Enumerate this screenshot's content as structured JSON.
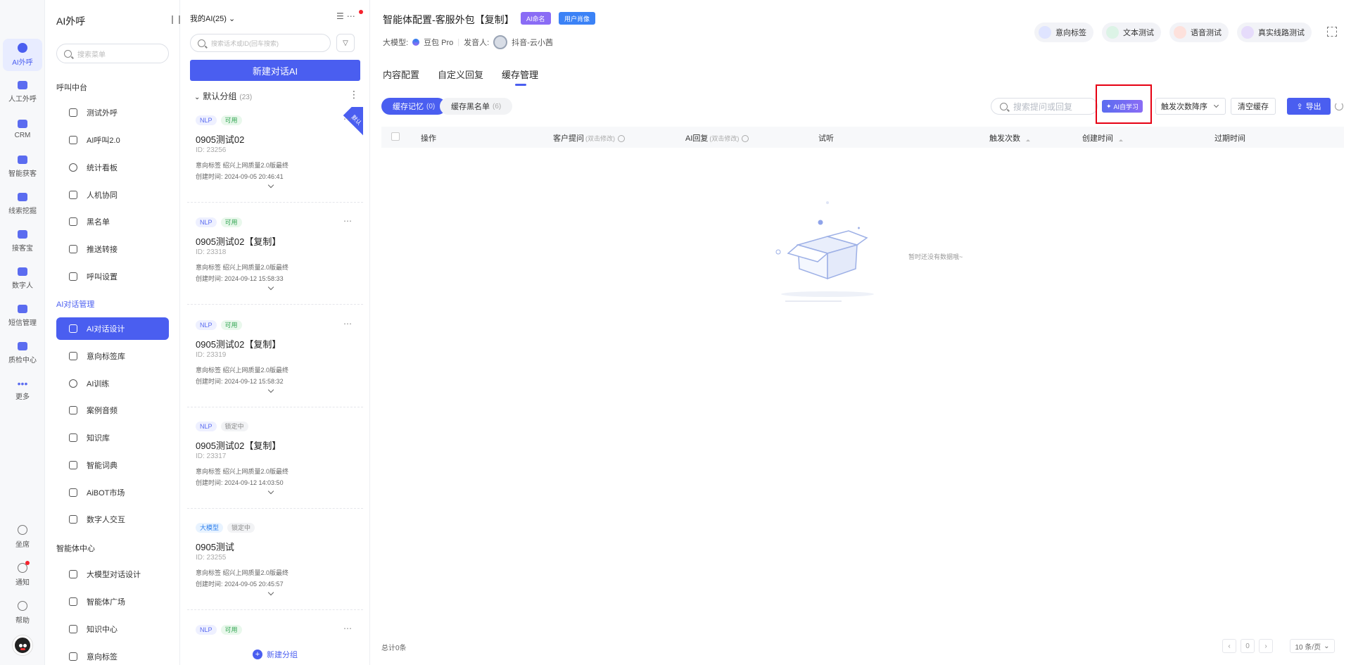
{
  "rail": [
    {
      "label": "AI外呼",
      "icon": "phone-robot-icon",
      "active": true
    },
    {
      "label": "人工外呼",
      "icon": "headset-icon"
    },
    {
      "label": "CRM",
      "icon": "crm-icon"
    },
    {
      "label": "智能获客",
      "icon": "target-icon"
    },
    {
      "label": "线索挖掘",
      "icon": "clue-icon"
    },
    {
      "label": "接客宝",
      "icon": "reception-icon"
    },
    {
      "label": "数字人",
      "icon": "digital-human-icon"
    },
    {
      "label": "短信管理",
      "icon": "sms-icon"
    },
    {
      "label": "质检中心",
      "icon": "inspect-icon"
    },
    {
      "label": "更多",
      "icon": "more-dots-icon"
    }
  ],
  "rail_bottom": [
    {
      "label": "坐席",
      "icon": "seat-icon"
    },
    {
      "label": "通知",
      "icon": "bell-icon"
    },
    {
      "label": "帮助",
      "icon": "help-icon"
    }
  ],
  "nav": {
    "title": "AI外呼",
    "search_placeholder": "搜索菜单",
    "group1": "呼叫中台",
    "group1_items": [
      "测试外呼",
      "AI呼叫2.0",
      "统计看板",
      "人机协同",
      "黑名单",
      "推送转接",
      "呼叫设置"
    ],
    "group2": "AI对话管理",
    "group2_items": [
      "AI对话设计",
      "意向标签库",
      "AI训练",
      "案例音频",
      "知识库",
      "智能词典",
      "AiBOT市场",
      "数字人交互"
    ],
    "group3": "智能体中心",
    "group3_items": [
      "大模型对话设计",
      "智能体广场",
      "知识中心",
      "意向标签"
    ]
  },
  "list": {
    "header": "我的AI(25)",
    "search_placeholder": "搜索话术或ID(回车搜索)",
    "new_button": "新建对话AI",
    "group_name": "默认分组",
    "group_count": "(23)",
    "footer": "新建分组",
    "cards": [
      {
        "tags": [
          "NLP",
          "可用"
        ],
        "name": "0905测试02",
        "id": "ID: 23256",
        "intent": "意向标签    绍兴上网质量2.0版最终",
        "time": "创建时间:  2024-09-05 20:46:41",
        "ribbon": "默认"
      },
      {
        "tags": [
          "NLP",
          "可用"
        ],
        "name": "0905测试02【复制】",
        "id": "ID: 23318",
        "intent": "意向标签    绍兴上网质量2.0版最终",
        "time": "创建时间:  2024-09-12 15:58:33"
      },
      {
        "tags": [
          "NLP",
          "可用"
        ],
        "name": "0905测试02【复制】",
        "id": "ID: 23319",
        "intent": "意向标签    绍兴上网质量2.0版最终",
        "time": "创建时间:  2024-09-12 15:58:32"
      },
      {
        "tags": [
          "NLP",
          "锁定中"
        ],
        "name": "0905测试02【复制】",
        "id": "ID: 23317",
        "intent": "意向标签    绍兴上网质量2.0版最终",
        "time": "创建时间:  2024-09-12 14:03:50"
      },
      {
        "tags": [
          "大模型",
          "锁定中"
        ],
        "name": "0905测试",
        "id": "ID: 23255",
        "intent": "意向标签    绍兴上网质量2.0版最终",
        "time": "创建时间:  2024-09-05 20:45:57"
      },
      {
        "tags": [
          "NLP",
          "可用"
        ],
        "name": "",
        "id": "",
        "intent": "",
        "time": ""
      }
    ]
  },
  "main": {
    "title": "智能体配置-客服外包【复制】",
    "badge_ai_name": "AI命名",
    "badge_persona": "用户肖像",
    "model_label": "大模型:",
    "model_value": "豆包 Pro",
    "speaker_label": "发音人:",
    "speaker_value": "抖音-云小茜",
    "top_buttons": [
      "意向标签",
      "文本测试",
      "语音测试",
      "真实线路测试"
    ],
    "tabs": [
      "内容配置",
      "自定义回复",
      "缓存管理"
    ],
    "active_tab": "缓存管理",
    "chip_memory": "缓存记忆",
    "chip_memory_count": "(0)",
    "chip_blacklist": "缓存黑名单",
    "chip_blacklist_count": "(6)",
    "search_placeholder": "搜索提问或回复",
    "ai_learn": "AI自学习",
    "sort_select": "触发次数降序",
    "clear_cache": "清空缓存",
    "export": "导出",
    "columns": {
      "op": "操作",
      "question": "客户提问",
      "question_hint": "(双击修改)",
      "answer": "AI回复",
      "answer_hint": "(双击修改)",
      "listen": "试听",
      "trigger": "触发次数",
      "created": "创建时间",
      "expire": "过期时间"
    },
    "empty_text": "暂时还没有数据哦~",
    "total": "总计0条",
    "page_current": "0",
    "page_size": "10 条/页"
  },
  "colors": {
    "primary": "#4a5ef0",
    "highlight": "#e60012"
  }
}
